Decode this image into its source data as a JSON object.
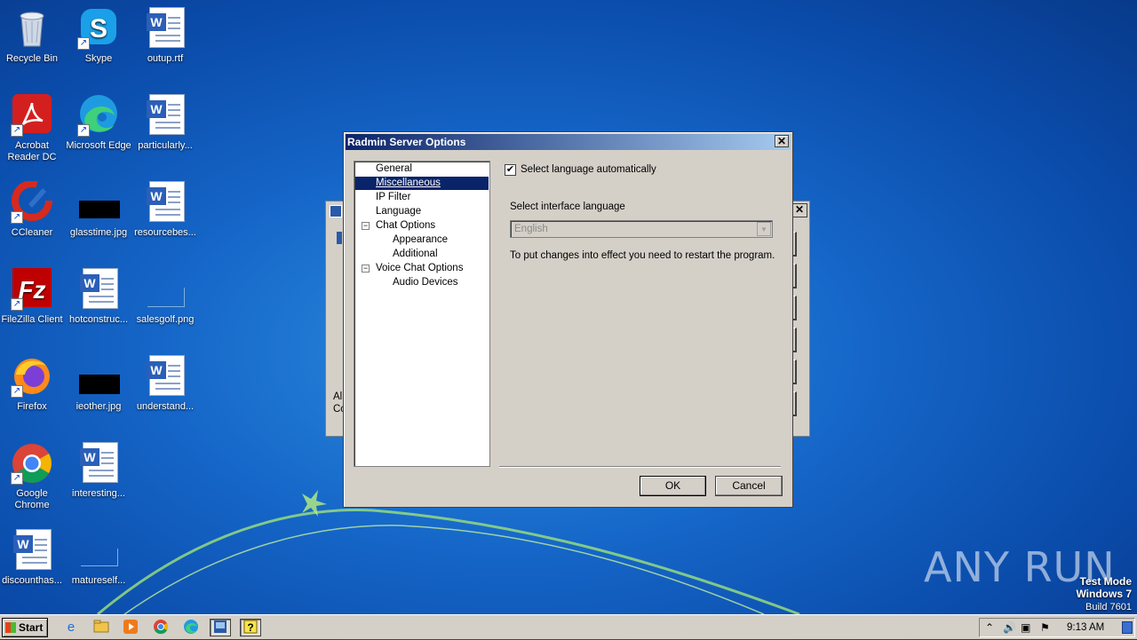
{
  "desktop": {
    "icons": [
      {
        "label": "Recycle Bin"
      },
      {
        "label": "Skype"
      },
      {
        "label": "outup.rtf"
      },
      {
        "label": "Acrobat Reader DC"
      },
      {
        "label": "Microsoft Edge"
      },
      {
        "label": "particularly..."
      },
      {
        "label": "CCleaner"
      },
      {
        "label": "glasstime.jpg"
      },
      {
        "label": "resourcebes..."
      },
      {
        "label": "FileZilla Client"
      },
      {
        "label": "hotconstruc..."
      },
      {
        "label": "salesgolf.png"
      },
      {
        "label": "Firefox"
      },
      {
        "label": "ieother.jpg"
      },
      {
        "label": "understand..."
      },
      {
        "label": "Google Chrome"
      },
      {
        "label": "interesting..."
      },
      {
        "label": "discounthas..."
      },
      {
        "label": "matureself..."
      }
    ]
  },
  "background_window": {
    "partial_text_1": "Al",
    "partial_text_2": "Co"
  },
  "dialog": {
    "title": "Radmin Server Options",
    "tree": [
      {
        "label": "General"
      },
      {
        "label": "Miscellaneous"
      },
      {
        "label": "IP Filter"
      },
      {
        "label": "Language"
      },
      {
        "label": "Chat Options"
      },
      {
        "label": "Appearance"
      },
      {
        "label": "Additional"
      },
      {
        "label": "Voice Chat Options"
      },
      {
        "label": "Audio Devices"
      }
    ],
    "selected_item": "Miscellaneous",
    "auto_language_label": "Select language automatically",
    "auto_language_checked": true,
    "interface_language_label": "Select interface language",
    "language_value": "English",
    "restart_note": "To put changes into effect you need to restart the program.",
    "ok_label": "OK",
    "cancel_label": "Cancel"
  },
  "taskbar": {
    "start_label": "Start",
    "clock": "9:13 AM"
  },
  "watermark": {
    "brand": "ANY RUN",
    "line1": "Test Mode",
    "line2": "Windows 7",
    "line3": "Build 7601"
  }
}
